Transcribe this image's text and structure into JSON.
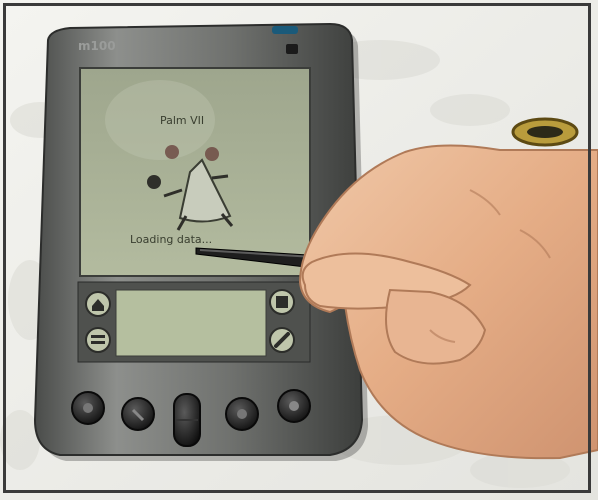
{
  "device": {
    "brand_label": "m100",
    "screen_title": "Palm VII",
    "screen_status": "Loading data...",
    "colors": {
      "background": "#f2f2ee",
      "device_body": "#6b6d6b",
      "lcd": "#a9b197",
      "graffiti": "#b5bf9f",
      "button": "#2a2a2a",
      "skin": "#e8b08a",
      "stylus": "#1e1e1e"
    }
  },
  "icons": [
    "home-icon",
    "menu-icon",
    "calculator-icon",
    "find-icon",
    "datebook-icon",
    "address-icon",
    "scroll-button-icon",
    "todo-icon",
    "memo-icon"
  ]
}
